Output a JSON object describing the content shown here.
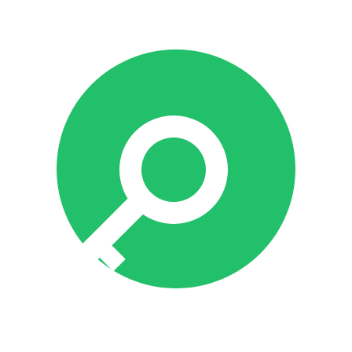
{
  "app_icon": {
    "icon": "key-icon",
    "colors": {
      "background": "#ffffff",
      "circle": "#22c06a",
      "key": "#ffffff"
    }
  }
}
